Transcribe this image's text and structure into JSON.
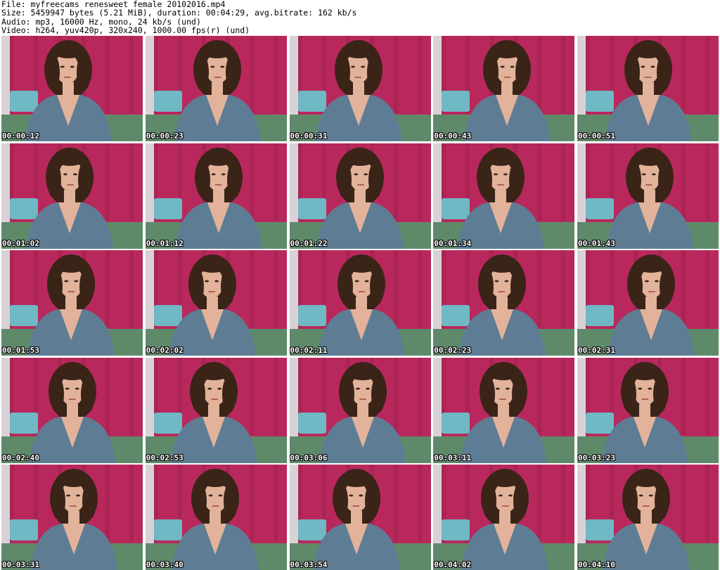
{
  "header": {
    "file_line": "File: myfreecams_renesweet_female_20102016.mp4",
    "size_line": "Size: 5459947 bytes (5.21 MiB), duration: 00:04:29, avg.bitrate: 162 kb/s",
    "audio_line": "Audio: mp3, 16000 Hz, mono, 24 kb/s (und)",
    "video_line": "Video: h264, yuv420p, 320x240, 1000.00 fps(r) (und)"
  },
  "colors": {
    "background": "#ffffff",
    "curtain": "#b9285c",
    "curtain_shadow": "#8f1c47",
    "floor": "#5f8a6a",
    "pillow": "#6fb8c4",
    "hair": "#3a2418",
    "skin": "#e2b39a",
    "sweater": "#5e7d94",
    "timestamp_text": "#ffffff"
  },
  "thumbnails": [
    {
      "timestamp": "00:00:12"
    },
    {
      "timestamp": "00:00:23"
    },
    {
      "timestamp": "00:00:31"
    },
    {
      "timestamp": "00:00:43"
    },
    {
      "timestamp": "00:00:51"
    },
    {
      "timestamp": "00:01:02"
    },
    {
      "timestamp": "00:01:12"
    },
    {
      "timestamp": "00:01:22"
    },
    {
      "timestamp": "00:01:34"
    },
    {
      "timestamp": "00:01:43"
    },
    {
      "timestamp": "00:01:53"
    },
    {
      "timestamp": "00:02:02"
    },
    {
      "timestamp": "00:02:11"
    },
    {
      "timestamp": "00:02:23"
    },
    {
      "timestamp": "00:02:31"
    },
    {
      "timestamp": "00:02:40"
    },
    {
      "timestamp": "00:02:53"
    },
    {
      "timestamp": "00:03:06"
    },
    {
      "timestamp": "00:03:11"
    },
    {
      "timestamp": "00:03:23"
    },
    {
      "timestamp": "00:03:31"
    },
    {
      "timestamp": "00:03:40"
    },
    {
      "timestamp": "00:03:54"
    },
    {
      "timestamp": "00:04:02"
    },
    {
      "timestamp": "00:04:10"
    }
  ]
}
